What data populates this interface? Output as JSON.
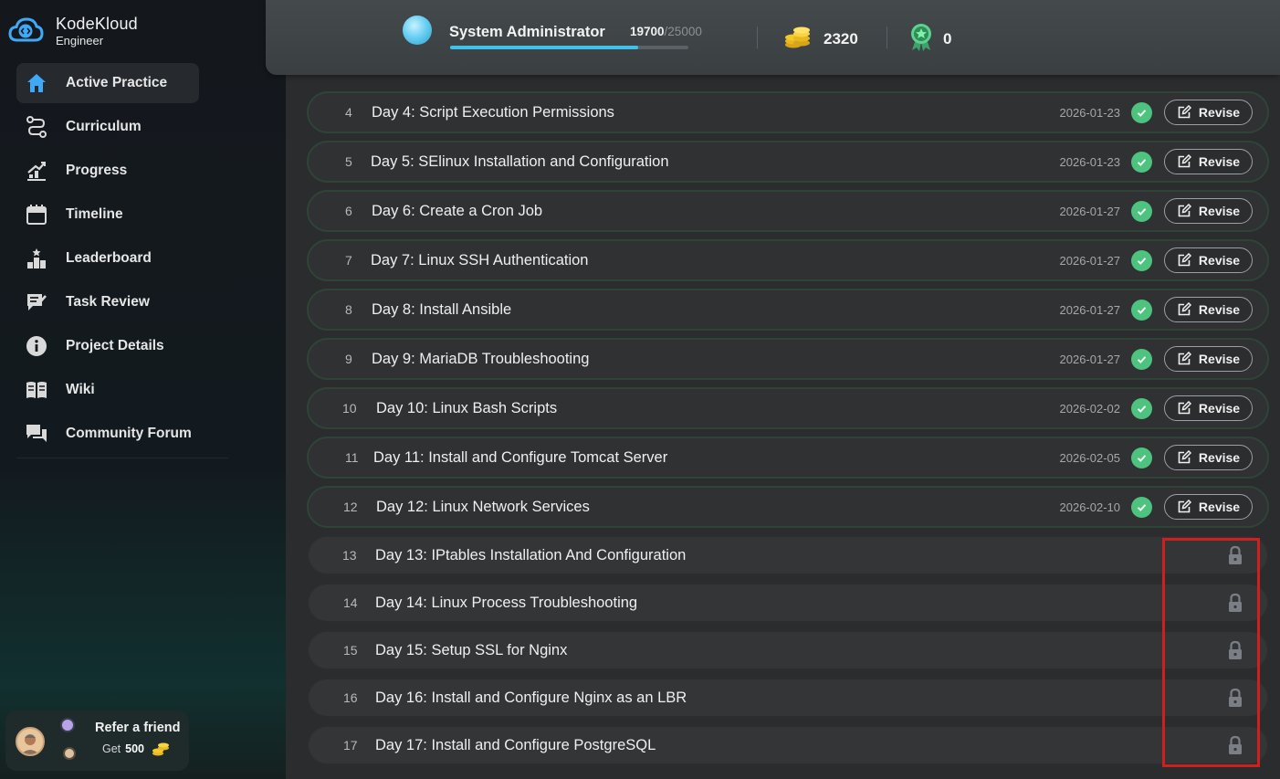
{
  "brand": {
    "name": "KodeKloud",
    "subtitle": "Engineer"
  },
  "sidebar": {
    "items": [
      {
        "label": "Active Practice",
        "icon": "home-icon",
        "active": true
      },
      {
        "label": "Curriculum",
        "icon": "route-icon"
      },
      {
        "label": "Progress",
        "icon": "progress-chart-icon"
      },
      {
        "label": "Timeline",
        "icon": "calendar-icon"
      },
      {
        "label": "Leaderboard",
        "icon": "leaderboard-icon"
      },
      {
        "label": "Task Review",
        "icon": "review-icon"
      },
      {
        "label": "Project Details",
        "icon": "info-icon"
      },
      {
        "label": "Wiki",
        "icon": "book-icon"
      },
      {
        "label": "Community Forum",
        "icon": "forum-icon"
      }
    ],
    "refer": {
      "title": "Refer a friend",
      "get_label": "Get",
      "amount": "500"
    }
  },
  "stats": {
    "role": "System Administrator",
    "xp_current": "19700",
    "xp_max": "/25000",
    "xp_fraction": 0.788,
    "coins": "2320",
    "badges": "0"
  },
  "tasks": [
    {
      "num": "4",
      "title": "Day 4: Script Execution Permissions",
      "date": "2026-01-23",
      "status": "done",
      "action": "Revise"
    },
    {
      "num": "5",
      "title": "Day 5: SElinux Installation and Configuration",
      "date": "2026-01-23",
      "status": "done",
      "action": "Revise"
    },
    {
      "num": "6",
      "title": "Day 6: Create a Cron Job",
      "date": "2026-01-27",
      "status": "done",
      "action": "Revise"
    },
    {
      "num": "7",
      "title": "Day 7: Linux SSH Authentication",
      "date": "2026-01-27",
      "status": "done",
      "action": "Revise"
    },
    {
      "num": "8",
      "title": "Day 8: Install Ansible",
      "date": "2026-01-27",
      "status": "done",
      "action": "Revise"
    },
    {
      "num": "9",
      "title": "Day 9: MariaDB Troubleshooting",
      "date": "2026-01-27",
      "status": "done",
      "action": "Revise"
    },
    {
      "num": "10",
      "title": "Day 10: Linux Bash Scripts",
      "date": "2026-02-02",
      "status": "done",
      "action": "Revise"
    },
    {
      "num": "11",
      "title": "Day 11: Install and Configure Tomcat Server",
      "date": "2026-02-05",
      "status": "done",
      "action": "Revise"
    },
    {
      "num": "12",
      "title": "Day 12: Linux Network Services",
      "date": "2026-02-10",
      "status": "done",
      "action": "Revise"
    },
    {
      "num": "13",
      "title": "Day 13: IPtables Installation And Configuration",
      "status": "locked"
    },
    {
      "num": "14",
      "title": "Day 14: Linux Process Troubleshooting",
      "status": "locked"
    },
    {
      "num": "15",
      "title": "Day 15: Setup SSL for Nginx",
      "status": "locked"
    },
    {
      "num": "16",
      "title": "Day 16: Install and Configure Nginx as an LBR",
      "status": "locked"
    },
    {
      "num": "17",
      "title": "Day 17: Install and Configure PostgreSQL",
      "status": "locked"
    }
  ],
  "colors": {
    "accent": "#3fc2ea",
    "success": "#4ec27f",
    "highlight": "#d01f1f"
  }
}
